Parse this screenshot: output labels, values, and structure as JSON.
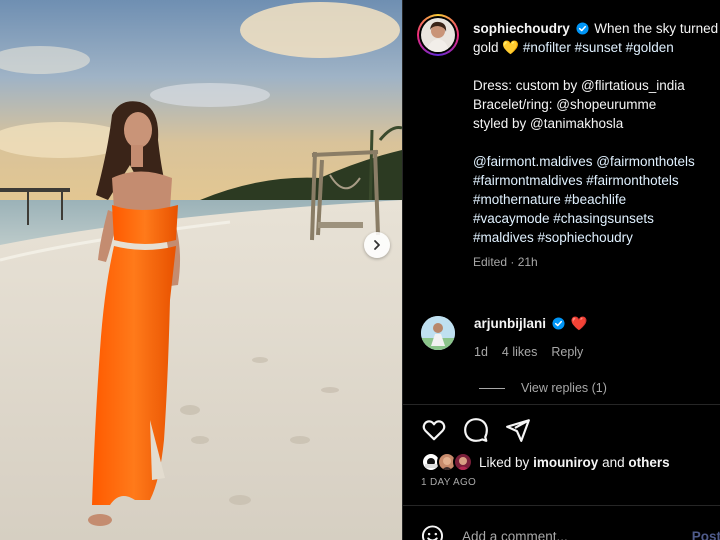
{
  "post": {
    "next_icon": "chevron-right-icon"
  },
  "caption": {
    "username": "sophiechoudry",
    "verified_icon": "verified-badge-icon",
    "text_1": "When the sky turned gold",
    "heart_emoji": "💛",
    "hashtags_1": "#nofilter #sunset #golden",
    "line_dress": "Dress: custom by @flirtatious_india",
    "line_bracelet": "Bracelet/ring: @shopeurumme",
    "line_styled": "styled by @tanimakhosla",
    "tags_line_1": "@fairmont.maldives @fairmonthotels",
    "tags_line_2": "#fairmontmaldives #fairmonthotels",
    "tags_line_3": "#mothernature #beachlife",
    "tags_line_4": "#vacaymode #chasingsunsets",
    "tags_line_5": "#maldives #sophiechoudry",
    "edited": "Edited · 21h"
  },
  "comment": {
    "username": "arjunbijlani",
    "text": "❤️",
    "age": "1d",
    "likes": "4 likes",
    "reply_label": "Reply",
    "view_replies": "View replies (1)"
  },
  "actions": {
    "like_icon": "heart-icon",
    "comment_icon": "comment-bubble-icon",
    "share_icon": "paper-plane-icon"
  },
  "likes": {
    "prefix": "Liked by",
    "user": "imouniroy",
    "conj": "and",
    "others": "others"
  },
  "date": "1 DAY AGO",
  "add_comment": {
    "placeholder": "Add a comment...",
    "post_label": "Post",
    "emoji_icon": "smiley-icon"
  },
  "colors": {
    "background": "#000000",
    "text": "#f5f5f5",
    "muted": "#a8a8a8",
    "verified": "#0095f6",
    "dress_orange": "#ff6a0d"
  }
}
